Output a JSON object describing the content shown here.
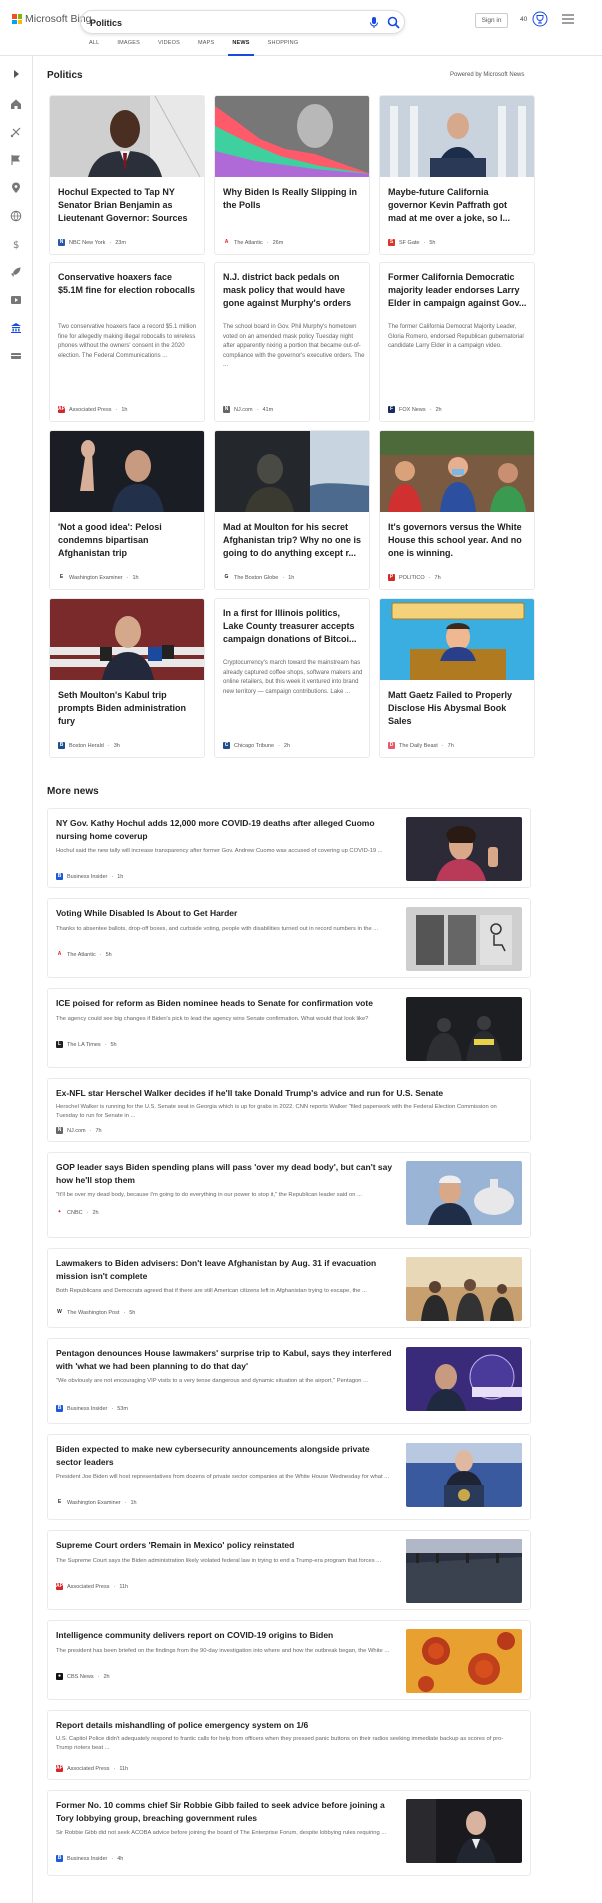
{
  "header": {
    "brand": "Microsoft Bing",
    "search_value": "Politics",
    "signin_label": "Sign in",
    "points": "40"
  },
  "tabs": [
    {
      "label": "ALL"
    },
    {
      "label": "IMAGES"
    },
    {
      "label": "VIDEOS"
    },
    {
      "label": "MAPS"
    },
    {
      "label": "NEWS"
    },
    {
      "label": "SHOPPING"
    }
  ],
  "section": {
    "title": "Politics",
    "powered_by": "Powered by Microsoft News",
    "more_title": "More news"
  },
  "cards": [
    {
      "title": "Hochul Expected to Tap NY Senator Brian Benjamin as Lieutenant Governor: Sources",
      "source": "NBC New York",
      "time": "23m",
      "logo_color": "#2a58a8"
    },
    {
      "title": "Why Biden Is Really Slipping in the Polls",
      "source": "The Atlantic",
      "time": "26m",
      "logo_color": "#e02020"
    },
    {
      "title": "Maybe-future California governor Kevin Paffrath got mad at me over a joke, so I...",
      "source": "SF Gate",
      "time": "5h",
      "logo_color": "#d9352b"
    },
    {
      "title": "Conservative hoaxers face $5.1M fine for election robocalls",
      "snippet": "Two conservative hoaxers face a record $5.1 million fine for allegedly making illegal robocalls to wireless phones without the owners' consent in the 2020 election. The Federal Communications ...",
      "source": "Associated Press",
      "time": "1h",
      "logo_color": "#d9262d"
    },
    {
      "title": "N.J. district back pedals on mask policy that would have gone against Murphy's orders",
      "snippet": "The school board in Gov. Phil Murphy's hometown voted on an amended mask policy Tuesday night after apparently nixing a portion that became out-of-compliance with the governor's executive orders. The ...",
      "source": "NJ.com",
      "time": "41m",
      "logo_color": "#666666"
    },
    {
      "title": "Former California Democratic majority leader endorses Larry Elder in campaign against Gov...",
      "snippet": "The former California Democrat Majority Leader, Gloria Romero, endorsed Republican gubernatorial candidate Larry Elder in a campaign video.",
      "source": "FOX News",
      "time": "2h",
      "logo_color": "#1a2a5c"
    },
    {
      "title": "'Not a good idea': Pelosi condemns bipartisan Afghanistan trip",
      "source": "Washington Examiner",
      "time": "1h",
      "logo_color": "#333333"
    },
    {
      "title": "Mad at Moulton for his secret Afghanistan trip? Why no one is going to do anything except r...",
      "source": "The Boston Globe",
      "time": "1h",
      "logo_color": "#222222"
    },
    {
      "title": "It's governors versus the White House this school year. And no one is winning.",
      "source": "POLITICO",
      "time": "7h",
      "logo_color": "#d32a2a"
    },
    {
      "title": "Seth Moulton's Kabul trip prompts Biden administration fury",
      "source": "Boston Herald",
      "time": "3h",
      "logo_color": "#1b4f8f"
    },
    {
      "title": "In a first for Illinois politics, Lake County treasurer accepts campaign donations of Bitcoi...",
      "snippet": "Cryptocurrency's march toward the mainstream has already captured coffee shops, software makers and online retailers, but this week it ventured into brand new territory — campaign contributions. Lake ...",
      "source": "Chicago Tribune",
      "time": "2h",
      "logo_color": "#1f4e8c"
    },
    {
      "title": "Matt Gaetz Failed to Properly Disclose His Abysmal Book Sales",
      "source": "The Daily Beast",
      "time": "7h",
      "logo_color": "#e8596b"
    }
  ],
  "more": [
    {
      "title": "NY Gov. Kathy Hochul adds 12,000 more COVID-19 deaths after alleged Cuomo nursing home coverup",
      "snippet": "Hochul said the new tally will increase transparency after former Gov. Andrew Cuomo was accused of covering up COVID-19 ...",
      "source": "Business Insider",
      "time": "1h",
      "logo_color": "#1e5bd8"
    },
    {
      "title": "Voting While Disabled Is About to Get Harder",
      "snippet": "Thanks to absentee ballots, drop-off boxes, and curbside voting, people with disabilities turned out in record numbers in the ...",
      "source": "The Atlantic",
      "time": "5h",
      "logo_color": "#e02020"
    },
    {
      "title": "ICE poised for reform as Biden nominee heads to Senate for confirmation vote",
      "snippet": "The agency could see big changes if Biden's pick to lead the agency wins Senate confirmation. What would that look like?",
      "source": "The LA Times",
      "time": "5h",
      "logo_color": "#222222"
    },
    {
      "title": "Ex-NFL star Herschel Walker decides if he'll take Donald Trump's advice and run for U.S. Senate",
      "snippet": "Herschel Walker is running for the U.S. Senate seat in Georgia which is up for grabs in 2022. CNN reports Walker \"filed paperwork with the Federal Election Commission on Tuesday to run for Senate in ...",
      "source": "NJ.com",
      "time": "7h",
      "logo_color": "#666666"
    },
    {
      "title": "GOP leader says Biden spending plans will pass 'over my dead body', but can't say how he'll stop them",
      "snippet": "\"It'll be over my dead body, because I'm going to do everything in our power to stop it,\" the Republican leader said on ...",
      "source": "CNBC",
      "time": "2h",
      "logo_color": "#cc3333"
    },
    {
      "title": "Lawmakers to Biden advisers: Don't leave Afghanistan by Aug. 31 if evacuation mission isn't complete",
      "snippet": "Both Republicans and Democrats agreed that if there are still American citizens left in Afghanistan trying to escape, the ...",
      "source": "The Washington Post",
      "time": "5h",
      "logo_color": "#333333"
    },
    {
      "title": "Pentagon denounces House lawmakers' surprise trip to Kabul, says they interfered with 'what we had been planning to do that day'",
      "snippet": "\"We obviously are not encouraging VIP visits to a very tense dangerous and dynamic situation at the airport,\" Pentagon ...",
      "source": "Business Insider",
      "time": "53m",
      "logo_color": "#1e5bd8"
    },
    {
      "title": "Biden expected to make new cybersecurity announcements alongside private sector leaders",
      "snippet": "President Joe Biden will host representatives from dozens of private sector companies at the White House Wednesday for what ...",
      "source": "Washington Examiner",
      "time": "1h",
      "logo_color": "#333333"
    },
    {
      "title": "Supreme Court orders 'Remain in Mexico' policy reinstated",
      "snippet": "The Supreme Court says the Biden administration likely violated federal law in trying to end a Trump-era program that forces ...",
      "source": "Associated Press",
      "time": "11h",
      "logo_color": "#d9262d"
    },
    {
      "title": "Intelligence community delivers report on COVID-19 origins to Biden",
      "snippet": "The president has been briefed on the findings from the 90-day investigation into where and how the outbreak began, the White ...",
      "source": "CBS News",
      "time": "2h",
      "logo_color": "#111111"
    },
    {
      "title": "Report details mishandling of police emergency system on 1/6",
      "snippet": "U.S. Capitol Police didn't adequately respond to frantic calls for help from officers when they pressed panic buttons on their radios seeking immediate backup as scores of pro-Trump rioters beat ...",
      "source": "Associated Press",
      "time": "11h",
      "logo_color": "#d9262d"
    },
    {
      "title": "Former No. 10 comms chief Sir Robbie Gibb failed to seek advice before joining a Tory lobbying group, breaching government rules",
      "snippet": "Sir Robbie Gibb did not seek ACOBA advice before joining the board of The Enterprise Forum, despite lobbying rules requiring ...",
      "source": "Business Insider",
      "time": "4h",
      "logo_color": "#1e5bd8"
    }
  ],
  "colors": {
    "accent": "#174ae4"
  }
}
